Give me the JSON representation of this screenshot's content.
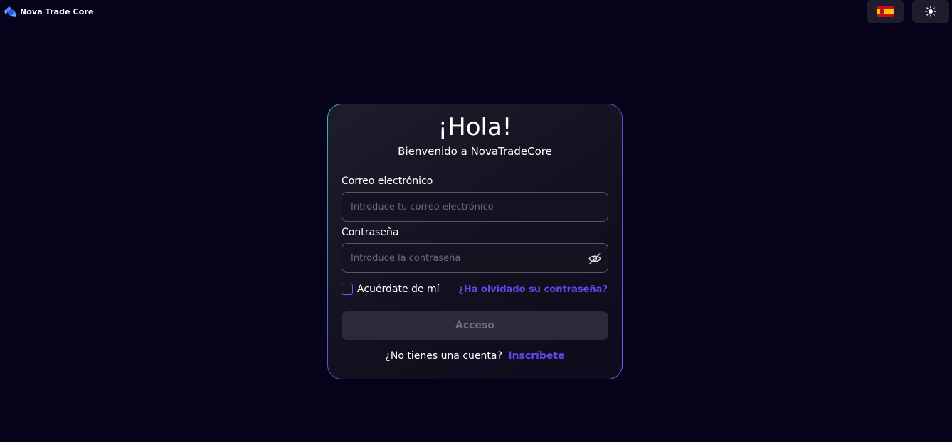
{
  "header": {
    "brand_name": "Nova Trade Core",
    "language_icon": "spain-flag-icon",
    "theme_icon": "sun-icon"
  },
  "login": {
    "title": "¡Hola!",
    "subtitle": "Bienvenido a NovaTradeCore",
    "email_label": "Correo electrónico",
    "email_placeholder": "Introduce tu correo electrónico",
    "email_value": "",
    "password_label": "Contraseña",
    "password_placeholder": "Introduce la contraseña",
    "password_value": "",
    "remember_label": "Acuérdate de mí",
    "forgot_link": "¿Ha olvidado su contraseña?",
    "submit_label": "Acceso",
    "no_account_text": "¿No tienes una cuenta?",
    "signup_link": "Inscríbete"
  },
  "colors": {
    "background": "#05021a",
    "accent": "#5e48ea",
    "card_border_start": "#3fb8a4",
    "card_border_end": "#7b56e6"
  }
}
